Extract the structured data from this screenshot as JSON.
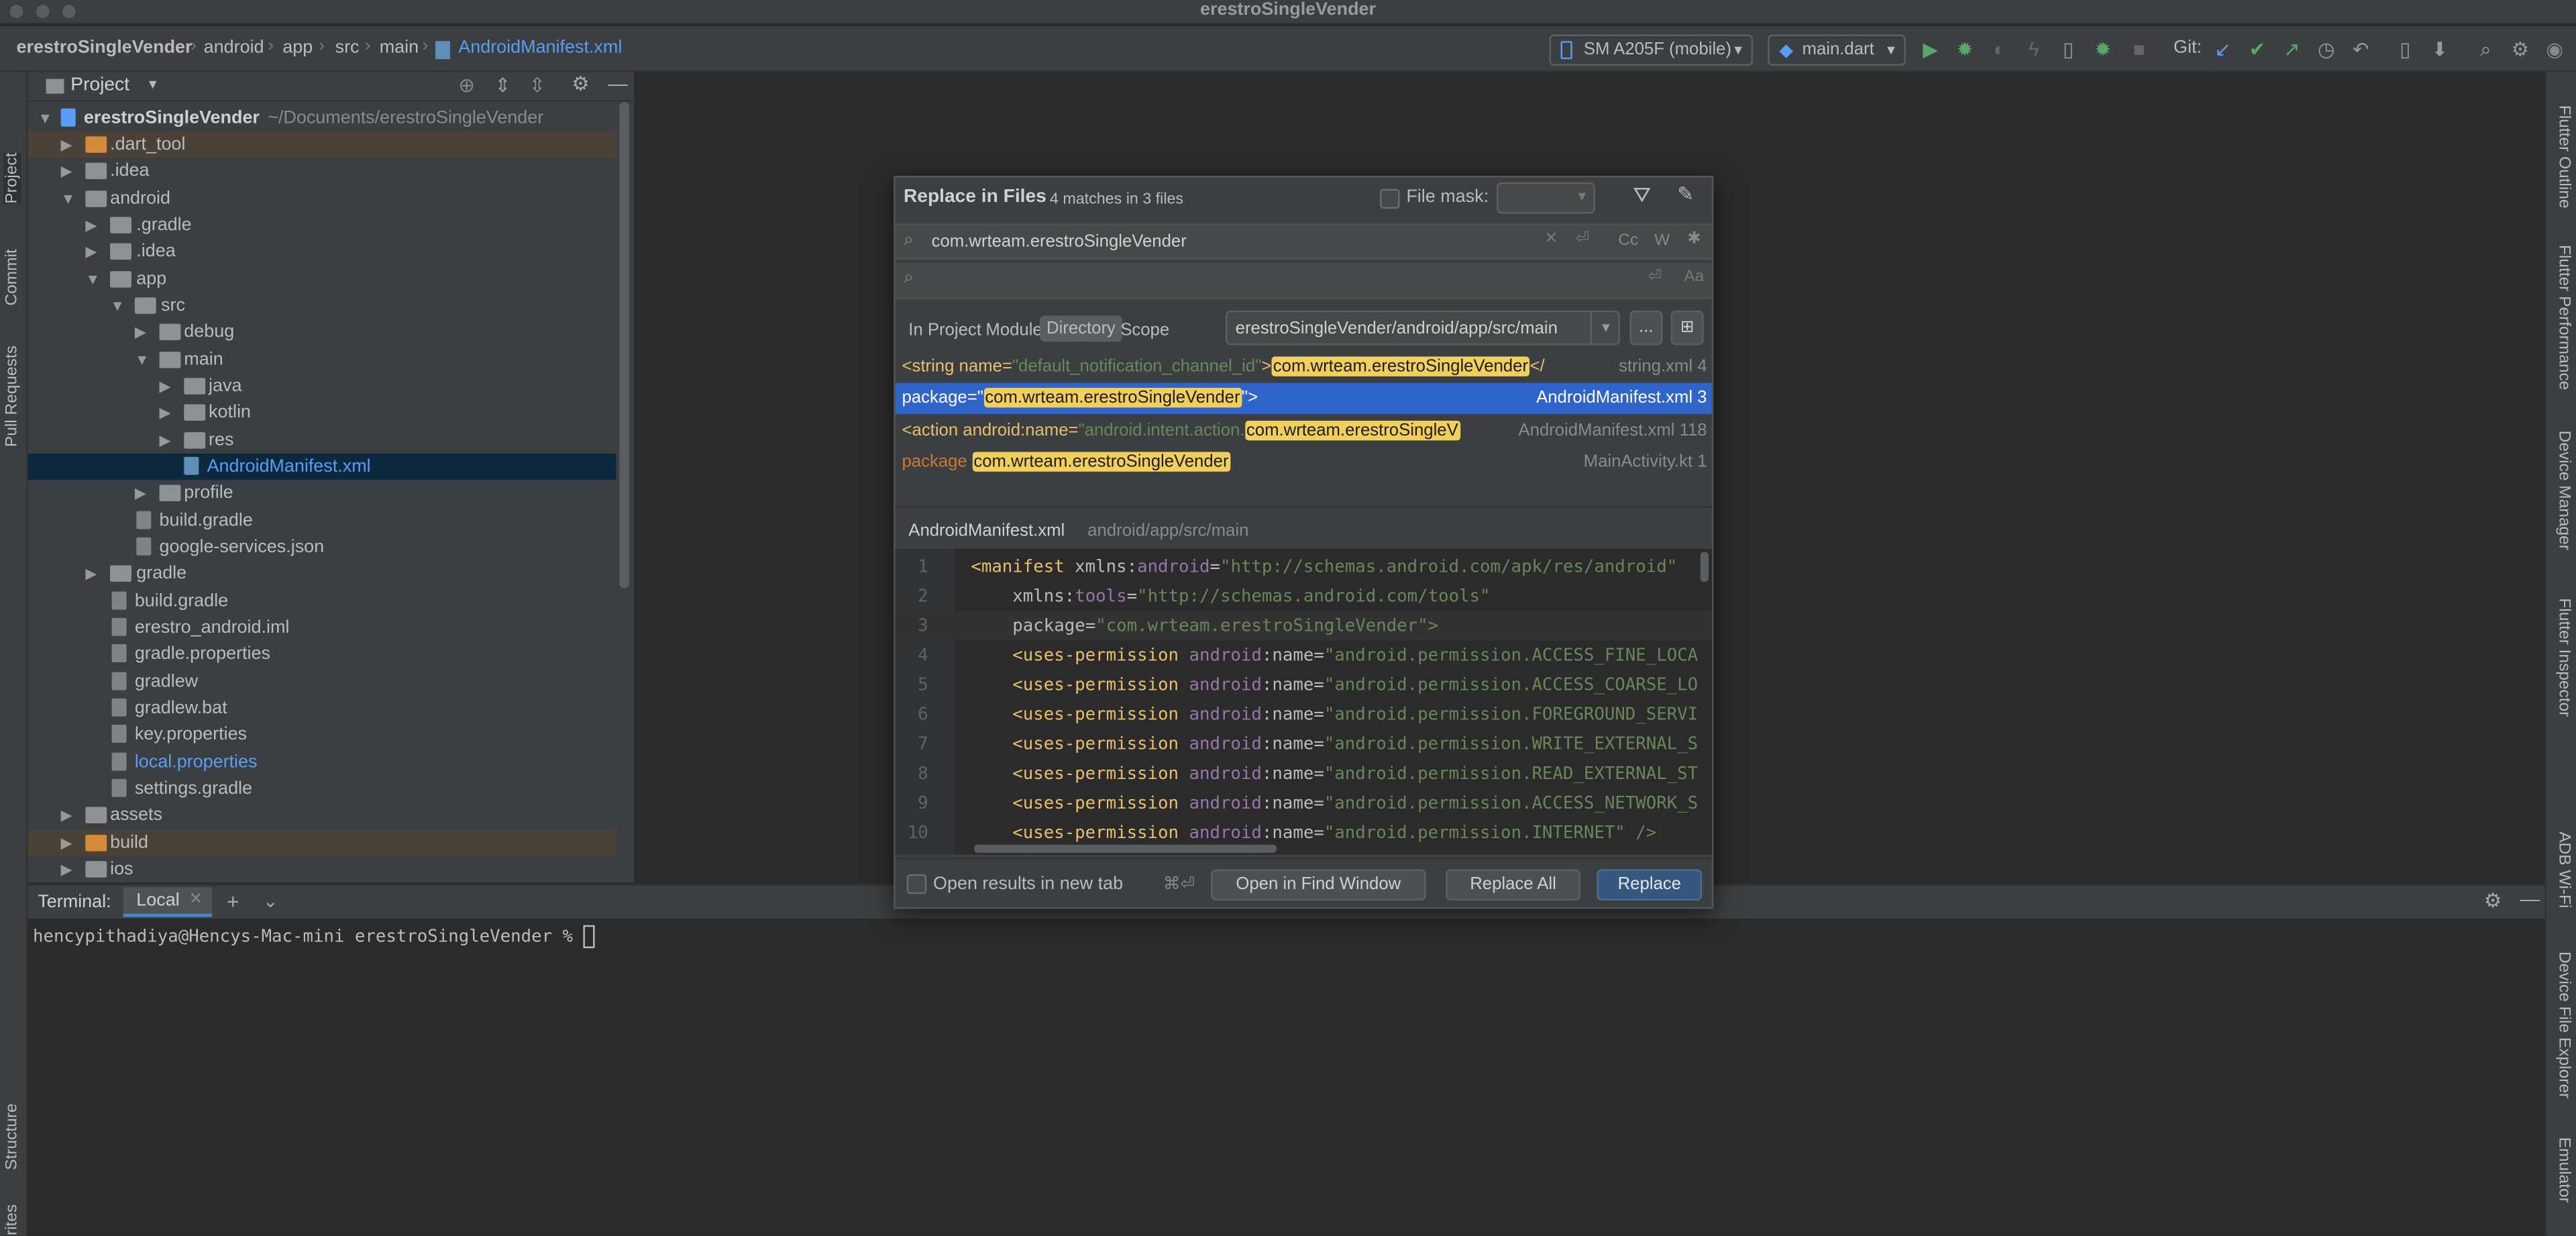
{
  "window": {
    "title": "erestroSingleVender"
  },
  "breadcrumb": [
    "erestroSingleVender",
    "android",
    "app",
    "src",
    "main",
    "AndroidManifest.xml"
  ],
  "toolbar": {
    "device": "SM A205F (mobile)",
    "run_config": "main.dart",
    "git_label": "Git:"
  },
  "left_stripe": {
    "project": "Project",
    "commit": "Commit",
    "pull_requests": "Pull Requests",
    "structure": "Structure",
    "favorites": "Favorites"
  },
  "right_stripe": {
    "flutter_outline": "Flutter Outline",
    "flutter_performance": "Flutter Performance",
    "device_manager": "Device Manager",
    "flutter_inspector": "Flutter Inspector",
    "adb_wifi": "ADB Wi-Fi",
    "device_file_explorer": "Device File Explorer",
    "emulator": "Emulator"
  },
  "project_panel": {
    "title": "Project",
    "root_name": "erestroSingleVender",
    "root_path": "~/Documents/erestroSingleVender",
    "items": [
      {
        "label": "erestroSingleVender"
      },
      {
        "label": ".dart_tool"
      },
      {
        "label": ".idea"
      },
      {
        "label": "android"
      },
      {
        "label": ".gradle"
      },
      {
        "label": ".idea"
      },
      {
        "label": "app"
      },
      {
        "label": "src"
      },
      {
        "label": "debug"
      },
      {
        "label": "main"
      },
      {
        "label": "java"
      },
      {
        "label": "kotlin"
      },
      {
        "label": "res"
      },
      {
        "label": "AndroidManifest.xml"
      },
      {
        "label": "profile"
      },
      {
        "label": "build.gradle"
      },
      {
        "label": "google-services.json"
      },
      {
        "label": "gradle"
      },
      {
        "label": "build.gradle"
      },
      {
        "label": "erestro_android.iml"
      },
      {
        "label": "gradle.properties"
      },
      {
        "label": "gradlew"
      },
      {
        "label": "gradlew.bat"
      },
      {
        "label": "key.properties"
      },
      {
        "label": "local.properties"
      },
      {
        "label": "settings.gradle"
      },
      {
        "label": "assets"
      },
      {
        "label": "build"
      },
      {
        "label": "ios"
      }
    ]
  },
  "dialog": {
    "title": "Replace in Files",
    "match_summary": "4 matches in 3 files",
    "file_mask_label": "File mask:",
    "search_text": "com.wrteam.erestroSingleVender",
    "replace_text": "",
    "scope_tabs": [
      {
        "label": "In Project"
      },
      {
        "label": "Module"
      },
      {
        "label": "Directory"
      },
      {
        "label": "Scope"
      }
    ],
    "directory_path": "erestroSingleVender/android/app/src/main",
    "browse_label": "...",
    "toggles": {
      "case": "Cc",
      "word": "W"
    },
    "results": [
      {
        "pre": "<string name=",
        "attr": "\"default_notification_channel_id\"",
        "mid": ">",
        "match": "com.wrteam.erestroSingleVender",
        "post": "</",
        "file": "string.xml 4"
      },
      {
        "pre": "package=\"",
        "attr": "",
        "mid": "",
        "match": "com.wrteam.erestroSingleVender",
        "post": "\">",
        "file": "AndroidManifest.xml 3"
      },
      {
        "pre": "<action android:name=",
        "attr": "\"android.intent.action.",
        "mid": "",
        "match": "com.wrteam.erestroSingleV",
        "post": "",
        "file": "AndroidManifest.xml 118"
      },
      {
        "pre": "package ",
        "attr": "",
        "mid": "",
        "match": "com.wrteam.erestroSingleVender",
        "post": "",
        "file": "MainActivity.kt 1"
      }
    ],
    "preview_file": "AndroidManifest.xml",
    "preview_path": "android/app/src/main",
    "code_lines": [
      {
        "n": "1",
        "a": "<manifest ",
        "b": "xmlns:",
        "c": "android",
        "d": "=",
        "e": "\"http://schemas.android.com/apk/res/android\""
      },
      {
        "n": "2",
        "a": "    ",
        "b": "xmlns:",
        "c": "tools",
        "d": "=",
        "e": "\"http://schemas.android.com/tools\""
      },
      {
        "n": "3",
        "a": "    ",
        "b": "",
        "c": "package",
        "d": "=",
        "e": "\"com.wrteam.erestroSingleVender\">"
      },
      {
        "n": "4",
        "a": "    <uses-permission ",
        "b": "android",
        "c": ":name",
        "d": "=",
        "e": "\"android.permission.ACCESS_FINE_LOCA"
      },
      {
        "n": "5",
        "a": "    <uses-permission ",
        "b": "android",
        "c": ":name",
        "d": "=",
        "e": "\"android.permission.ACCESS_COARSE_LO"
      },
      {
        "n": "6",
        "a": "    <uses-permission ",
        "b": "android",
        "c": ":name",
        "d": "=",
        "e": "\"android.permission.FOREGROUND_SERVI"
      },
      {
        "n": "7",
        "a": "    <uses-permission ",
        "b": "android",
        "c": ":name",
        "d": "=",
        "e": "\"android.permission.WRITE_EXTERNAL_S"
      },
      {
        "n": "8",
        "a": "    <uses-permission ",
        "b": "android",
        "c": ":name",
        "d": "=",
        "e": "\"android.permission.READ_EXTERNAL_ST"
      },
      {
        "n": "9",
        "a": "    <uses-permission ",
        "b": "android",
        "c": ":name",
        "d": "=",
        "e": "\"android.permission.ACCESS_NETWORK_S"
      },
      {
        "n": "10",
        "a": "    <uses-permission ",
        "b": "android",
        "c": ":name",
        "d": "=",
        "e": "\"android.permission.INTERNET\" />"
      }
    ],
    "open_new_tab_label": "Open results in new tab",
    "shortcut": "⌘⏎",
    "btn_open_find": "Open in Find Window",
    "btn_replace_all": "Replace All",
    "btn_replace": "Replace"
  },
  "terminal": {
    "label": "Terminal:",
    "tab": "Local",
    "prompt": "hencypithadiya@Hencys-Mac-mini erestroSingleVender % "
  },
  "colors": {
    "accent": "#2f65ca",
    "match_highlight": "#f2cf5b",
    "panel": "#3c3f41",
    "editor": "#2b2b2b"
  }
}
